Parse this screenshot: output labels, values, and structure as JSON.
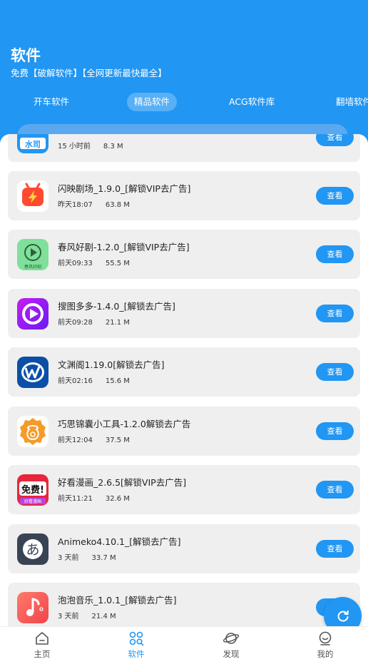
{
  "header": {
    "title": "软件",
    "subtitle": "免费【破解软件】【全网更新最快最全】"
  },
  "tabs": [
    {
      "label": "开车软件"
    },
    {
      "label": "精品软件"
    },
    {
      "label": "ACG软件库"
    },
    {
      "label": "翻墙软件"
    }
  ],
  "active_tab": "精品软件",
  "view_label": "查看",
  "apps": [
    {
      "name": "",
      "time": "15 小时前",
      "size": "8.3 M",
      "icon": "partial-app-icon"
    },
    {
      "name": "闪映剧场_1.9.0_[解锁VIP去广告]",
      "time": "昨天18:07",
      "size": "63.8 M",
      "icon": "tv-play-icon"
    },
    {
      "name": "春风好剧-1.2.0_[解锁VIP去广告]",
      "time": "前天09:33",
      "size": "55.5 M",
      "icon": "play-circle-icon"
    },
    {
      "name": "搜图多多-1.4.0_[解锁去广告]",
      "time": "前天09:28",
      "size": "21.1 M",
      "icon": "purple-play-icon"
    },
    {
      "name": "文渊阁1.19.0[解锁去广告]",
      "time": "前天02:16",
      "size": "15.6 M",
      "icon": "w-logo-icon"
    },
    {
      "name": "巧思锦囊小工具-1.2.0解锁去广告",
      "time": "前天12:04",
      "size": "37.5 M",
      "icon": "pouch-icon"
    },
    {
      "name": "好看漫画_2.6.5[解锁VIP去广告]",
      "time": "前天11:21",
      "size": "32.6 M",
      "icon": "free-badge-icon"
    },
    {
      "name": "Animeko4.10.1_[解锁去广告]",
      "time": "3 天前",
      "size": "33.7 M",
      "icon": "a-glyph-icon"
    },
    {
      "name": "泡泡音乐_1.0.1_[解锁去广告]",
      "time": "3 天前",
      "size": "21.4 M",
      "icon": "music-note-icon"
    }
  ],
  "icon_texts": {
    "chunfeng": "春风好剧",
    "free": "免费!",
    "haokan": "好看漫画",
    "a_glyph": "あ"
  },
  "nav": [
    {
      "label": "主页",
      "icon": "home-icon"
    },
    {
      "label": "软件",
      "icon": "apps-grid-icon"
    },
    {
      "label": "发现",
      "icon": "planet-icon"
    },
    {
      "label": "我的",
      "icon": "profile-icon"
    }
  ],
  "colors": {
    "accent": "#2196f3",
    "card": "#efefef"
  }
}
